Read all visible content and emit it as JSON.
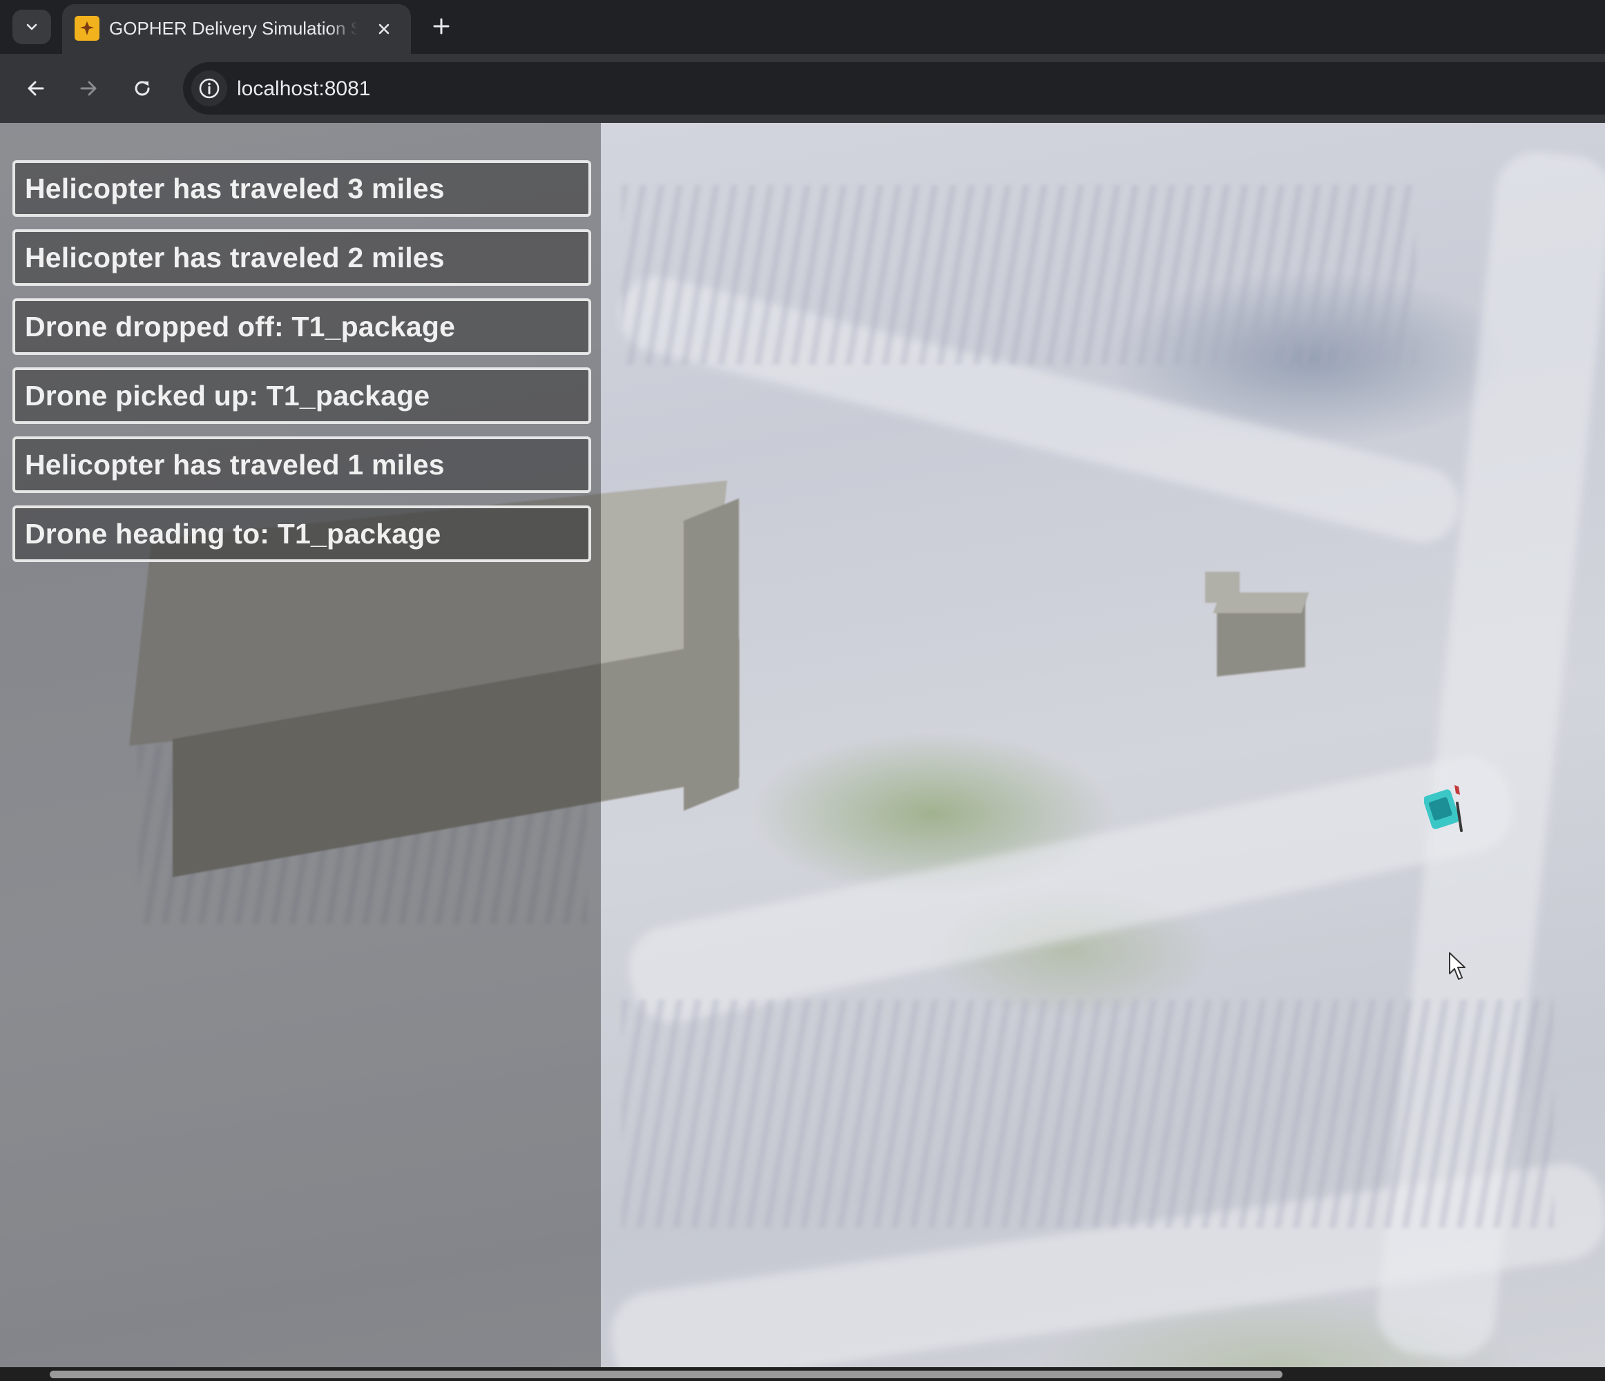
{
  "browser": {
    "tab_title": "GOPHER Delivery Simulation Sy",
    "url": "localhost:8081"
  },
  "icons": {
    "tab_list": "chevron-down-icon",
    "favicon": "gopher-logo-icon",
    "close": "close-icon",
    "new_tab": "plus-icon",
    "back": "back-arrow-icon",
    "forward": "forward-arrow-icon",
    "reload": "reload-icon",
    "site_info": "info-icon"
  },
  "log": {
    "entries": [
      "Helicopter has traveled 3 miles",
      "Helicopter has traveled 2 miles",
      "Drone dropped off: T1_package",
      "Drone picked up: T1_package",
      "Helicopter has traveled 1 miles",
      "Drone heading to: T1_package"
    ]
  },
  "colors": {
    "chrome_dark": "#202124",
    "chrome_toolbar": "#35363a",
    "log_border": "#e6e6e6",
    "drone": "#3cc7c7",
    "favicon": "#f2b21e"
  }
}
